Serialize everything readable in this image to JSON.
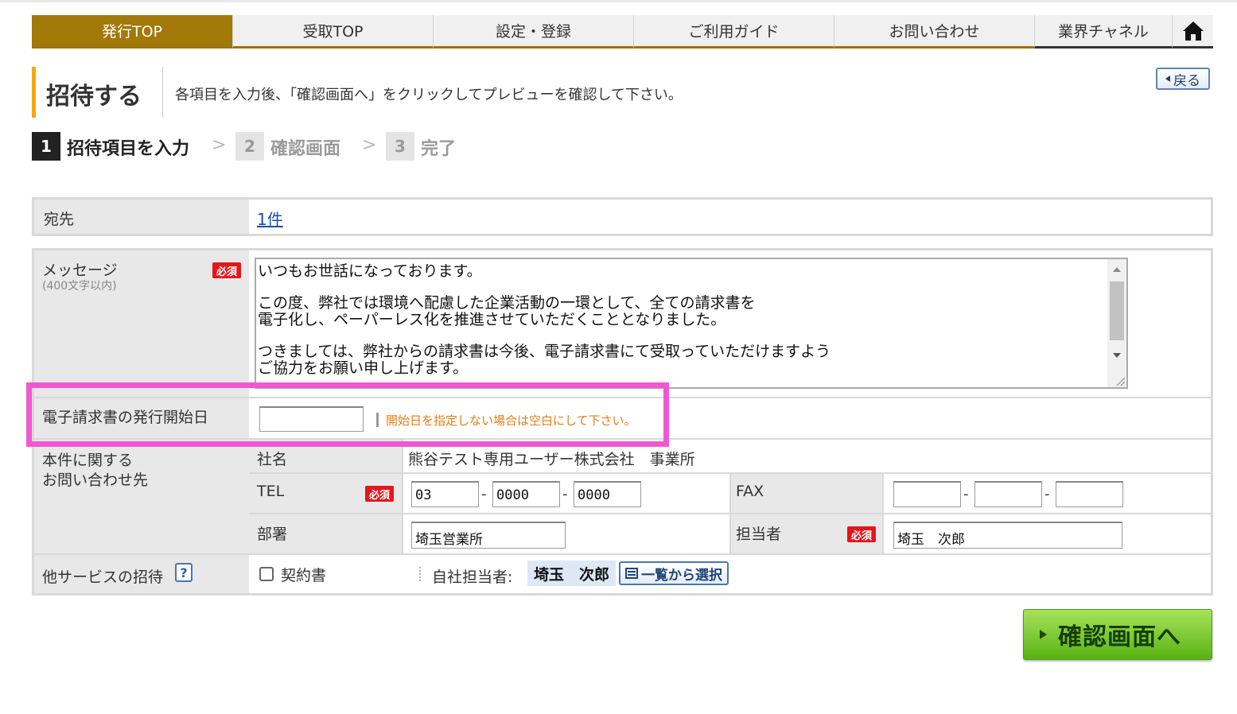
{
  "nav": {
    "tabs": [
      {
        "label": "発行TOP",
        "active": true
      },
      {
        "label": "受取TOP"
      },
      {
        "label": "設定・登録"
      },
      {
        "label": "ご利用ガイド"
      },
      {
        "label": "お問い合わせ"
      },
      {
        "label": "業界チャネル"
      }
    ],
    "home_icon": "home-icon"
  },
  "header": {
    "title": "招待する",
    "instruction": "各項目を入力後、「確認画面へ」をクリックしてプレビューを確認して下さい。",
    "back_label": "戻る"
  },
  "steps": [
    {
      "num": "1",
      "label": "招待項目を入力",
      "current": true
    },
    {
      "num": "2",
      "label": "確認画面"
    },
    {
      "num": "3",
      "label": "完了"
    }
  ],
  "recipient": {
    "label": "宛先",
    "value": "1件"
  },
  "required_label": "必須",
  "message": {
    "label": "メッセージ",
    "sublabel": "(400文字以内)",
    "lines": [
      "いつもお世話になっております。",
      "",
      "この度、弊社では環境へ配慮した企業活動の一環として、全ての請求書を",
      "電子化し、ペーパーレス化を推進させていただくこととなりました。",
      "",
      "つきましては、弊社からの請求書は今後、電子請求書にて受取っていただけますよう",
      "ご協力をお願い申し上げます。"
    ]
  },
  "start_date": {
    "label": "電子請求書の発行開始日",
    "value": "",
    "hint": "開始日を指定しない場合は空白にして下さい。"
  },
  "contact": {
    "label_line1": "本件に関する",
    "label_line2": "お問い合わせ先",
    "company_label": "社名",
    "company_value": "熊谷テスト専用ユーザー株式会社　事業所",
    "tel_label": "TEL",
    "tel": [
      "03",
      "0000",
      "0000"
    ],
    "fax_label": "FAX",
    "fax": [
      "",
      "",
      ""
    ],
    "dept_label": "部署",
    "dept_value": "埼玉営業所",
    "person_label": "担当者",
    "person_value": "埼玉　次郎"
  },
  "other_service": {
    "label": "他サービスの招待",
    "help": "?",
    "checkbox_label": "契約書",
    "staff_label": "自社担当者:",
    "staff_value": "埼玉　次郎",
    "select_label": "一覧から選択"
  },
  "confirm_button": "確認画面へ",
  "colors": {
    "nav_active": "#a27909",
    "accent_bar": "#f2a812",
    "required_badge": "#e3161c",
    "hint_text": "#e67e10",
    "highlight_box": "#f058d0",
    "confirm_button": "#59b314"
  }
}
